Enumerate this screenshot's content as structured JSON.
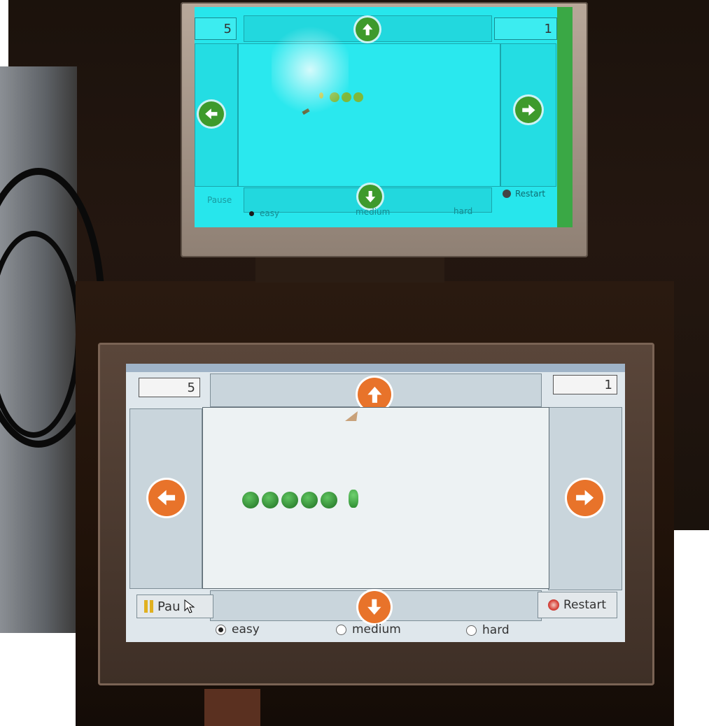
{
  "top_screen": {
    "score_left": "5",
    "score_right": "1",
    "pause_label": "Pause",
    "restart_label": "Restart",
    "difficulty": [
      {
        "label": "easy",
        "selected": true
      },
      {
        "label": "medium",
        "selected": false
      },
      {
        "label": "hard",
        "selected": false
      }
    ],
    "snake_segments": 3
  },
  "bottom_screen": {
    "score_left": "5",
    "score_right": "1",
    "pause_label": "Pau",
    "restart_label": "Restart",
    "difficulty": [
      {
        "label": "easy",
        "selected": true
      },
      {
        "label": "medium",
        "selected": false
      },
      {
        "label": "hard",
        "selected": false
      }
    ],
    "snake_segments": 5
  },
  "colors": {
    "top_screen_bg": "#27e6ec",
    "top_arrow": "#3e9a2c",
    "bottom_arrow": "#e8732a",
    "bottom_screen_bg": "#e9eef0",
    "snake": "#2f8f2f"
  },
  "icons": {
    "up": "arrow-up-icon",
    "down": "arrow-down-icon",
    "left": "arrow-left-icon",
    "right": "arrow-right-icon",
    "restart": "restart-icon",
    "pause": "pause-icon",
    "cursor": "cursor-icon",
    "food": "food-icon"
  }
}
